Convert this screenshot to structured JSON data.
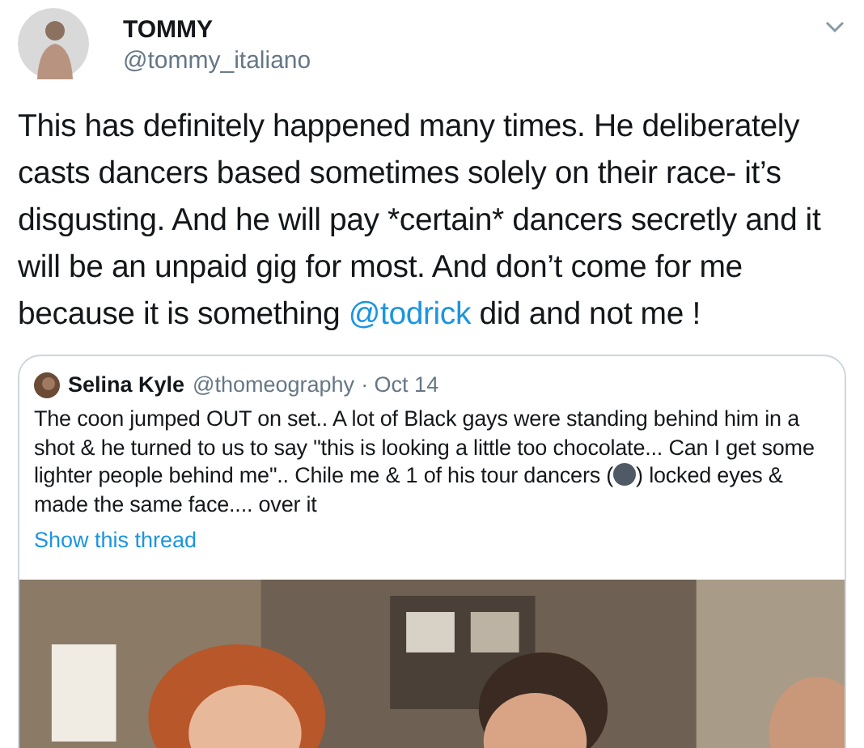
{
  "tweet": {
    "name": "TOMMY",
    "handle": "@tommy_italiano",
    "text_before": "This has definitely happened many times. He deliberately casts dancers based sometimes solely on their race- it’s disgusting. And he will pay *certain* dancers secretly and it will be an unpaid gig for most. And don’t come for me because it is something ",
    "mention": "@todrick",
    "text_after": " did and not me !"
  },
  "quoted_tweet": {
    "name": "Selina Kyle",
    "handle": "@thomeography",
    "date": "· Oct 14",
    "text_before": "The coon jumped OUT on set.. A lot of  Black gays were standing behind him in a shot & he turned to us to say \"this is looking a little too chocolate... Can I get some lighter people behind me\".. Chile me & 1 of his tour dancers (",
    "text_after": ") locked eyes & made the same face.... over it",
    "show_thread": "Show this thread"
  }
}
